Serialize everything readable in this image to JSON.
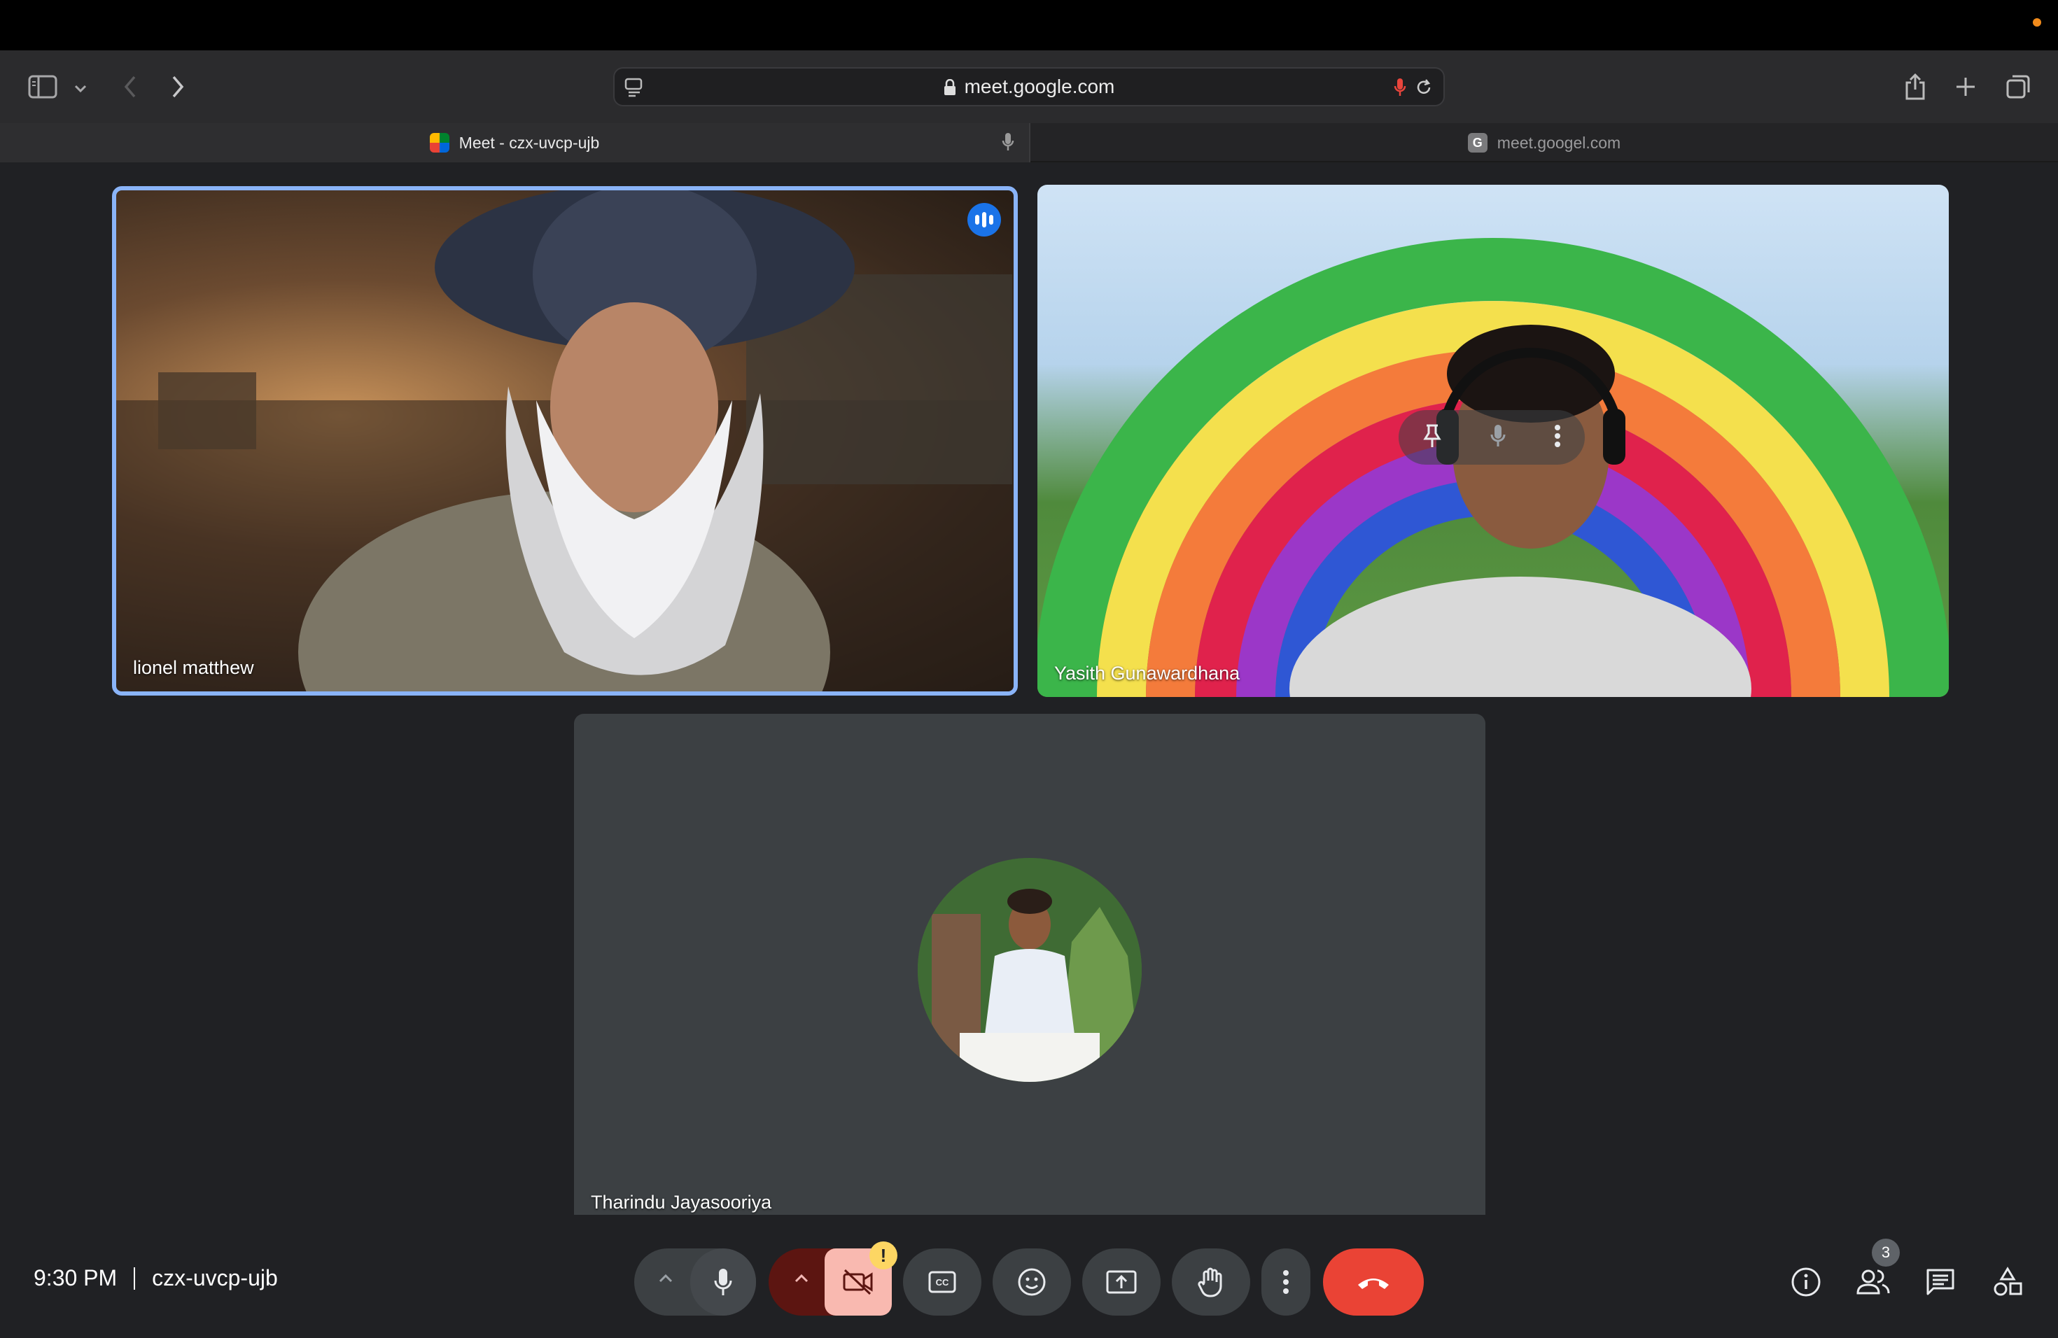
{
  "browser": {
    "url": "meet.google.com",
    "tabs": [
      {
        "label": "Meet - czx-uvcp-ujb",
        "active": true
      },
      {
        "label": "meet.googel.com",
        "active": false
      }
    ]
  },
  "participants": [
    {
      "name": "lionel matthew",
      "speaking": true
    },
    {
      "name": "Yasith Gunawardhana",
      "speaking": false
    },
    {
      "name": "Tharindu Jayasooriya",
      "camera_off": true
    }
  ],
  "bottom_bar": {
    "time": "9:30 PM",
    "meeting_code": "czx-uvcp-ujb",
    "people_count": "3",
    "camera_warning": "!"
  },
  "colors": {
    "active_tile_border": "#8ab4f8",
    "end_call": "#ea4335",
    "camera_off_bg": "#f9b9b0",
    "camera_off_chevron_bg": "#5c1511",
    "speaking_indicator": "#1a73e8",
    "warning": "#fdd663"
  }
}
